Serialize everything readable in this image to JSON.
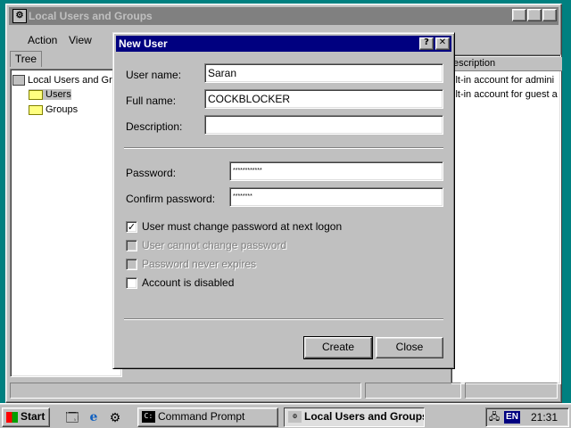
{
  "mmc": {
    "title": "Local Users and Groups",
    "menu": {
      "action": "Action",
      "view": "View"
    },
    "tree_tab": "Tree",
    "tree": {
      "root": "Local Users and Gro",
      "users": "Users",
      "groups": "Groups"
    },
    "list": {
      "header": "escription",
      "rows": [
        "ilt-in account for admini",
        "ilt-in account for guest a"
      ]
    }
  },
  "dialog": {
    "title": "New User",
    "help_label": "?",
    "close_label": "✕",
    "user_name_label": "User name:",
    "user_name_value": "Saran",
    "full_name_label": "Full name:",
    "full_name_value": "COCKBLOCKER",
    "description_label": "Description:",
    "description_value": "",
    "password_label": "Password:",
    "password_value": "************",
    "confirm_password_label": "Confirm password:",
    "confirm_password_value": "********",
    "options": [
      {
        "label": "User must change password at next logon",
        "checked": true,
        "enabled": true
      },
      {
        "label": "User cannot change password",
        "checked": false,
        "enabled": false
      },
      {
        "label": "Password never expires",
        "checked": false,
        "enabled": false
      },
      {
        "label": "Account is disabled",
        "checked": false,
        "enabled": true
      }
    ],
    "create_label": "Create",
    "close_button_label": "Close"
  },
  "taskbar": {
    "start_label": "Start",
    "tasks": [
      "Command Prompt",
      "Local Users and Groups"
    ],
    "lang": "EN",
    "clock": "21:31"
  }
}
